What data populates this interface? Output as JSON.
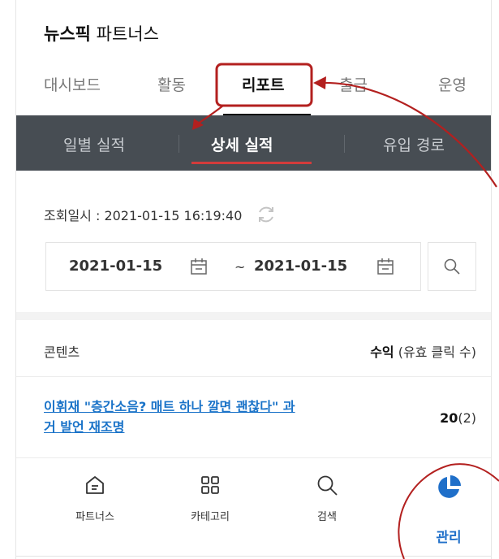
{
  "brand": {
    "bold": "뉴스픽",
    "rest": "파트너스"
  },
  "tabs": [
    {
      "label": "대시보드"
    },
    {
      "label": "활동"
    },
    {
      "label": "리포트"
    },
    {
      "label": "출금"
    },
    {
      "label": "운영"
    }
  ],
  "subtabs": [
    {
      "label": "일별 실적"
    },
    {
      "label": "상세 실적"
    },
    {
      "label": "유입 경로"
    }
  ],
  "lookup": {
    "text": "조회일시 : 2021-01-15 16:19:40"
  },
  "date_range": {
    "start": "2021-01-15",
    "separator": "~",
    "end": "2021-01-15"
  },
  "table": {
    "col_content": "콘텐츠",
    "col_revenue_strong": "수익",
    "col_revenue_rest": " (유효 클릭 수)",
    "rows": [
      {
        "title": "이휘재 \"층간소음? 매트 하나 깔면 괜찮다\" 과거 발언 재조명",
        "revenue": "20",
        "clicks": "(2)"
      }
    ]
  },
  "bottom_nav": [
    {
      "label": "파트너스",
      "icon": "home-icon"
    },
    {
      "label": "카테고리",
      "icon": "grid-icon"
    },
    {
      "label": "검색",
      "icon": "search-icon"
    },
    {
      "label": "관리",
      "icon": "pie-chart-icon"
    }
  ],
  "colors": {
    "accent_red": "#b3201f",
    "subnav_bg": "#474d53",
    "link_blue": "#1a73c8",
    "manage_blue": "#1f6fc9"
  }
}
